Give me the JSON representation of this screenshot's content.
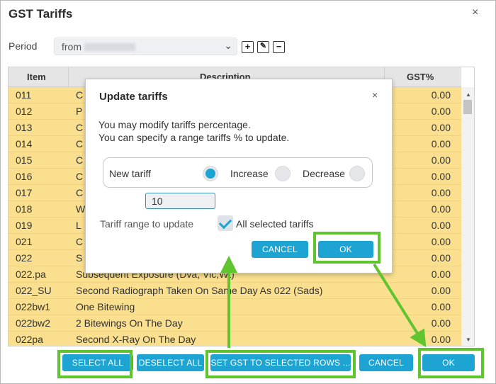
{
  "window": {
    "title": "GST Tariffs",
    "close_glyph": "×"
  },
  "period": {
    "label": "Period",
    "value": "from"
  },
  "toolbar": {
    "add_glyph": "+",
    "edit_glyph": "✎",
    "remove_glyph": "−"
  },
  "grid": {
    "headers": {
      "item": "Item",
      "description": "Description",
      "gst": "GST%"
    },
    "rows": [
      {
        "item": "011",
        "description": "C",
        "gst": "0.00"
      },
      {
        "item": "012",
        "description": "P",
        "gst": "0.00"
      },
      {
        "item": "013",
        "description": "C",
        "gst": "0.00"
      },
      {
        "item": "014",
        "description": "C",
        "gst": "0.00"
      },
      {
        "item": "015",
        "description": "C",
        "gst": "0.00"
      },
      {
        "item": "016",
        "description": "C",
        "gst": "0.00"
      },
      {
        "item": "017",
        "description": "C",
        "gst": "0.00"
      },
      {
        "item": "018",
        "description": "W",
        "gst": "0.00"
      },
      {
        "item": "019",
        "description": "L",
        "gst": "0.00"
      },
      {
        "item": "021",
        "description": "C",
        "gst": "0.00"
      },
      {
        "item": "022",
        "description": "S",
        "gst": "0.00"
      },
      {
        "item": "022.pa",
        "description": "Subsequent Exposure (Dva, Vic,Wt)",
        "gst": "0.00"
      },
      {
        "item": "022_SU",
        "description": "Second Radiograph Taken On Same Day As 022 (Sads)",
        "gst": "0.00"
      },
      {
        "item": "022bw1",
        "description": "One Bitewing",
        "gst": "0.00"
      },
      {
        "item": "022bw2",
        "description": "2 Bitewings On The Day",
        "gst": "0.00"
      },
      {
        "item": "022pa",
        "description": "Second X-Ray On The Day",
        "gst": "0.00"
      }
    ]
  },
  "buttons": {
    "select_all": "SELECT ALL",
    "deselect_all": "DESELECT ALL",
    "set_gst": "SET GST TO SELECTED ROWS ...",
    "cancel": "CANCEL",
    "ok": "OK"
  },
  "dialog": {
    "title": "Update tariffs",
    "close_glyph": "×",
    "line1": "You may modify tariffs percentage.",
    "line2": "You can specify a range tariffs % to update.",
    "opt_new": "New tariff",
    "opt_increase": "Increase",
    "opt_decrease": "Decrease",
    "selected_option": "New tariff",
    "tariff_value": "10",
    "range_label": "Tariff range to update",
    "check_label": "All selected tariffs",
    "cancel": "CANCEL",
    "ok": "OK"
  },
  "colors": {
    "accent": "#1ea4d2",
    "row_highlight": "#f9df8e",
    "annotation": "#5fc42e"
  }
}
